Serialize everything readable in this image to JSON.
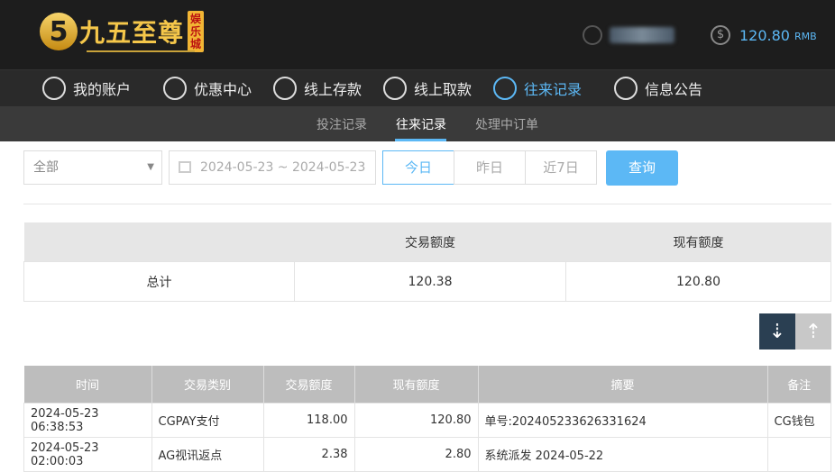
{
  "header": {
    "logo_mark": "5",
    "logo_text": "九五至尊",
    "logo_tag": "娱乐城",
    "balance_amount": "120.80",
    "balance_unit": "RMB"
  },
  "nav": {
    "items": [
      {
        "label": "我的账户",
        "icon": "user-icon"
      },
      {
        "label": "优惠中心",
        "icon": "gift-icon"
      },
      {
        "label": "线上存款",
        "icon": "deposit-icon"
      },
      {
        "label": "线上取款",
        "icon": "withdraw-icon"
      },
      {
        "label": "往来记录",
        "icon": "record-icon",
        "active": true
      },
      {
        "label": "信息公告",
        "icon": "bell-icon"
      }
    ]
  },
  "subnav": {
    "items": [
      "投注记录",
      "往来记录",
      "处理中订单"
    ],
    "active": "往来记录"
  },
  "filters": {
    "type_select": "全部",
    "date_range": "2024-05-23 ~ 2024-05-23",
    "quick": [
      "今日",
      "昨日",
      "近7日"
    ],
    "quick_active": "今日",
    "query_label": "查询"
  },
  "summary": {
    "headers": [
      "",
      "交易额度",
      "现有额度"
    ],
    "row": [
      "总计",
      "120.38",
      "120.80"
    ]
  },
  "detail": {
    "headers": [
      "时间",
      "交易类别",
      "交易额度",
      "现有额度",
      "摘要",
      "备注"
    ],
    "rows": [
      [
        "2024-05-23 06:38:53",
        "CGPAY支付",
        "118.00",
        "120.80",
        "单号:2024052336263316​24",
        "CG钱包"
      ],
      [
        "2024-05-23 02:00:03",
        "AG视讯返点",
        "2.38",
        "2.80",
        "系统派发  2024-05-22",
        ""
      ]
    ]
  },
  "colors": {
    "accent": "#5cb8f5",
    "header_bg": "#1d1d1d"
  }
}
